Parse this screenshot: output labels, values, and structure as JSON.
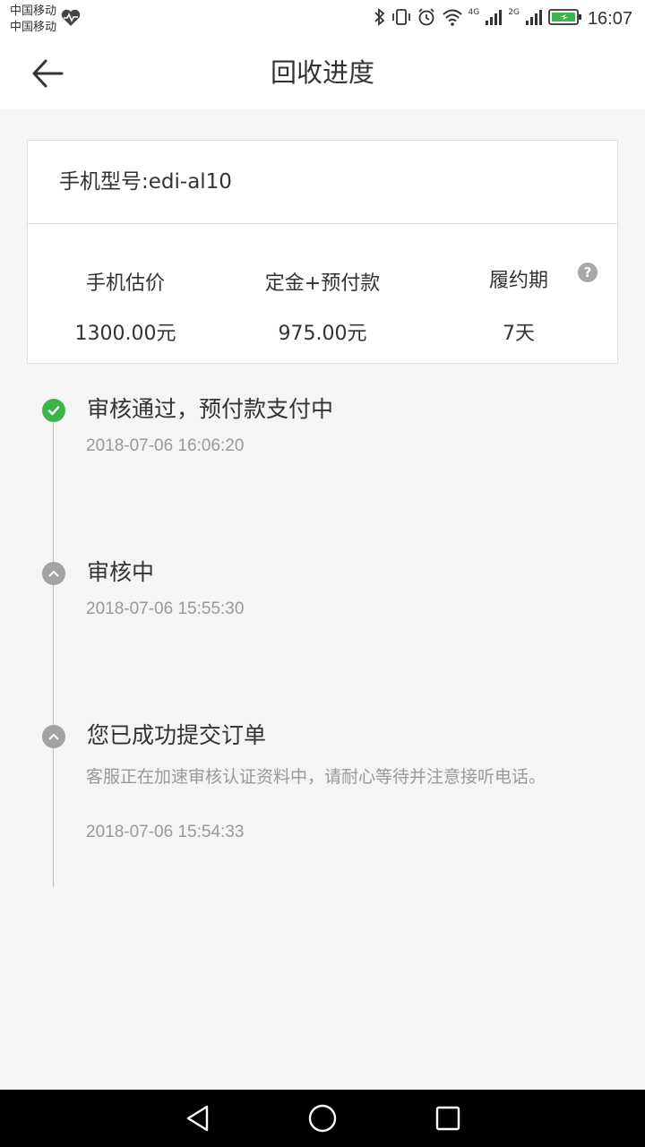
{
  "status_bar": {
    "carrier_1": "中国移动",
    "carrier_2": "中国移动",
    "network_1": "4G",
    "network_2": "2G",
    "time": "16:07"
  },
  "header": {
    "title": "回收进度",
    "back_icon": "arrow-left-icon"
  },
  "card": {
    "model": "手机型号:edi-al10",
    "stats": [
      {
        "label": "手机估价",
        "value": "1300.00元"
      },
      {
        "label": "定金+预付款",
        "value": "975.00元"
      },
      {
        "label": "履约期",
        "value": "7天"
      }
    ],
    "help_icon": "?"
  },
  "timeline": [
    {
      "status": "done",
      "title": "审核通过，预付款支付中",
      "desc": "",
      "time": "2018-07-06 16:06:20"
    },
    {
      "status": "pending",
      "title": "审核中",
      "desc": "",
      "time": "2018-07-06 15:55:30"
    },
    {
      "status": "pending",
      "title": "您已成功提交订单",
      "desc": "客服正在加速审核认证资料中，请耐心等待并注意接听电话。",
      "time": "2018-07-06 15:54:33"
    }
  ],
  "colors": {
    "done_green": "#3cb44a",
    "pending_gray": "#a3a3a3",
    "background": "#f5f5f5"
  }
}
